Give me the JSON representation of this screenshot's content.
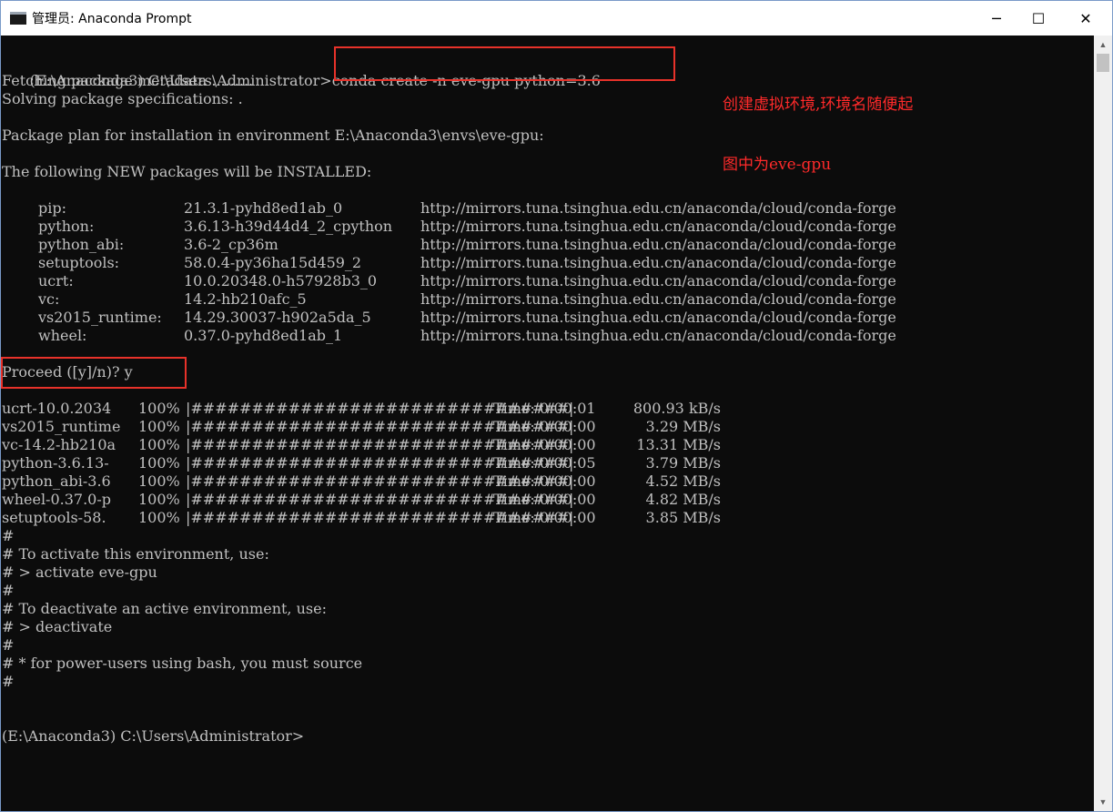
{
  "window": {
    "title": "管理员: Anaconda Prompt",
    "minimize_glyph": "─",
    "maximize_glyph": "☐",
    "close_glyph": "✕"
  },
  "terminal": {
    "prompt1": "(E:\\Anaconda3) C:\\Users\\Administrator>",
    "command1": "conda create -n eve-gpu python=3.6",
    "fetching": "Fetching package metadata .........",
    "solving": "Solving package specifications: .",
    "plan": "Package plan for installation in environment E:\\Anaconda3\\envs\\eve-gpu:",
    "following": "The following NEW packages will be INSTALLED:",
    "packages": [
      {
        "name": "pip:",
        "version": "21.3.1-pyhd8ed1ab_0",
        "channel": "http://mirrors.tuna.tsinghua.edu.cn/anaconda/cloud/conda-forge"
      },
      {
        "name": "python:",
        "version": "3.6.13-h39d44d4_2_cpython",
        "channel": "http://mirrors.tuna.tsinghua.edu.cn/anaconda/cloud/conda-forge"
      },
      {
        "name": "python_abi:",
        "version": "3.6-2_cp36m",
        "channel": "http://mirrors.tuna.tsinghua.edu.cn/anaconda/cloud/conda-forge"
      },
      {
        "name": "setuptools:",
        "version": "58.0.4-py36ha15d459_2",
        "channel": "http://mirrors.tuna.tsinghua.edu.cn/anaconda/cloud/conda-forge"
      },
      {
        "name": "ucrt:",
        "version": "10.0.20348.0-h57928b3_0",
        "channel": "http://mirrors.tuna.tsinghua.edu.cn/anaconda/cloud/conda-forge"
      },
      {
        "name": "vc:",
        "version": "14.2-hb210afc_5",
        "channel": "http://mirrors.tuna.tsinghua.edu.cn/anaconda/cloud/conda-forge"
      },
      {
        "name": "vs2015_runtime:",
        "version": "14.29.30037-h902a5da_5",
        "channel": "http://mirrors.tuna.tsinghua.edu.cn/anaconda/cloud/conda-forge"
      },
      {
        "name": "wheel:",
        "version": "0.37.0-pyhd8ed1ab_1",
        "channel": "http://mirrors.tuna.tsinghua.edu.cn/anaconda/cloud/conda-forge"
      }
    ],
    "proceed": "Proceed ([y]/n)? y",
    "downloads": [
      {
        "name": "ucrt-10.0.2034",
        "pct": "100%",
        "bar": "|###############################|",
        "time": "Time: 0:00:01",
        "speed": "800.93 kB/s"
      },
      {
        "name": "vs2015_runtime",
        "pct": "100%",
        "bar": "|###############################|",
        "time": "Time: 0:00:00",
        "speed": "3.29 MB/s"
      },
      {
        "name": "vc-14.2-hb210a",
        "pct": "100%",
        "bar": "|###############################|",
        "time": "Time: 0:00:00",
        "speed": "13.31 MB/s"
      },
      {
        "name": "python-3.6.13-",
        "pct": "100%",
        "bar": "|###############################|",
        "time": "Time: 0:00:05",
        "speed": "3.79 MB/s"
      },
      {
        "name": "python_abi-3.6",
        "pct": "100%",
        "bar": "|###############################|",
        "time": "Time: 0:00:00",
        "speed": "4.52 MB/s"
      },
      {
        "name": "wheel-0.37.0-p",
        "pct": "100%",
        "bar": "|###############################|",
        "time": "Time: 0:00:00",
        "speed": "4.82 MB/s"
      },
      {
        "name": "setuptools-58.",
        "pct": "100%",
        "bar": "|###############################|",
        "time": "Time: 0:00:00",
        "speed": "3.85 MB/s"
      }
    ],
    "hints": [
      "#",
      "# To activate this environment, use:",
      "# > activate eve-gpu",
      "#",
      "# To deactivate an active environment, use:",
      "# > deactivate",
      "#",
      "# * for power-users using bash, you must source",
      "#"
    ],
    "prompt2": "(E:\\Anaconda3) C:\\Users\\Administrator>"
  },
  "annotation": {
    "line1": "创建虚拟环境,环境名随便起",
    "line2": "图中为eve-gpu"
  },
  "colors": {
    "terminal_bg": "#0c0c0c",
    "terminal_fg": "#c0c0c0",
    "highlight": "#e8322a",
    "annotation": "#ff2a2a"
  }
}
